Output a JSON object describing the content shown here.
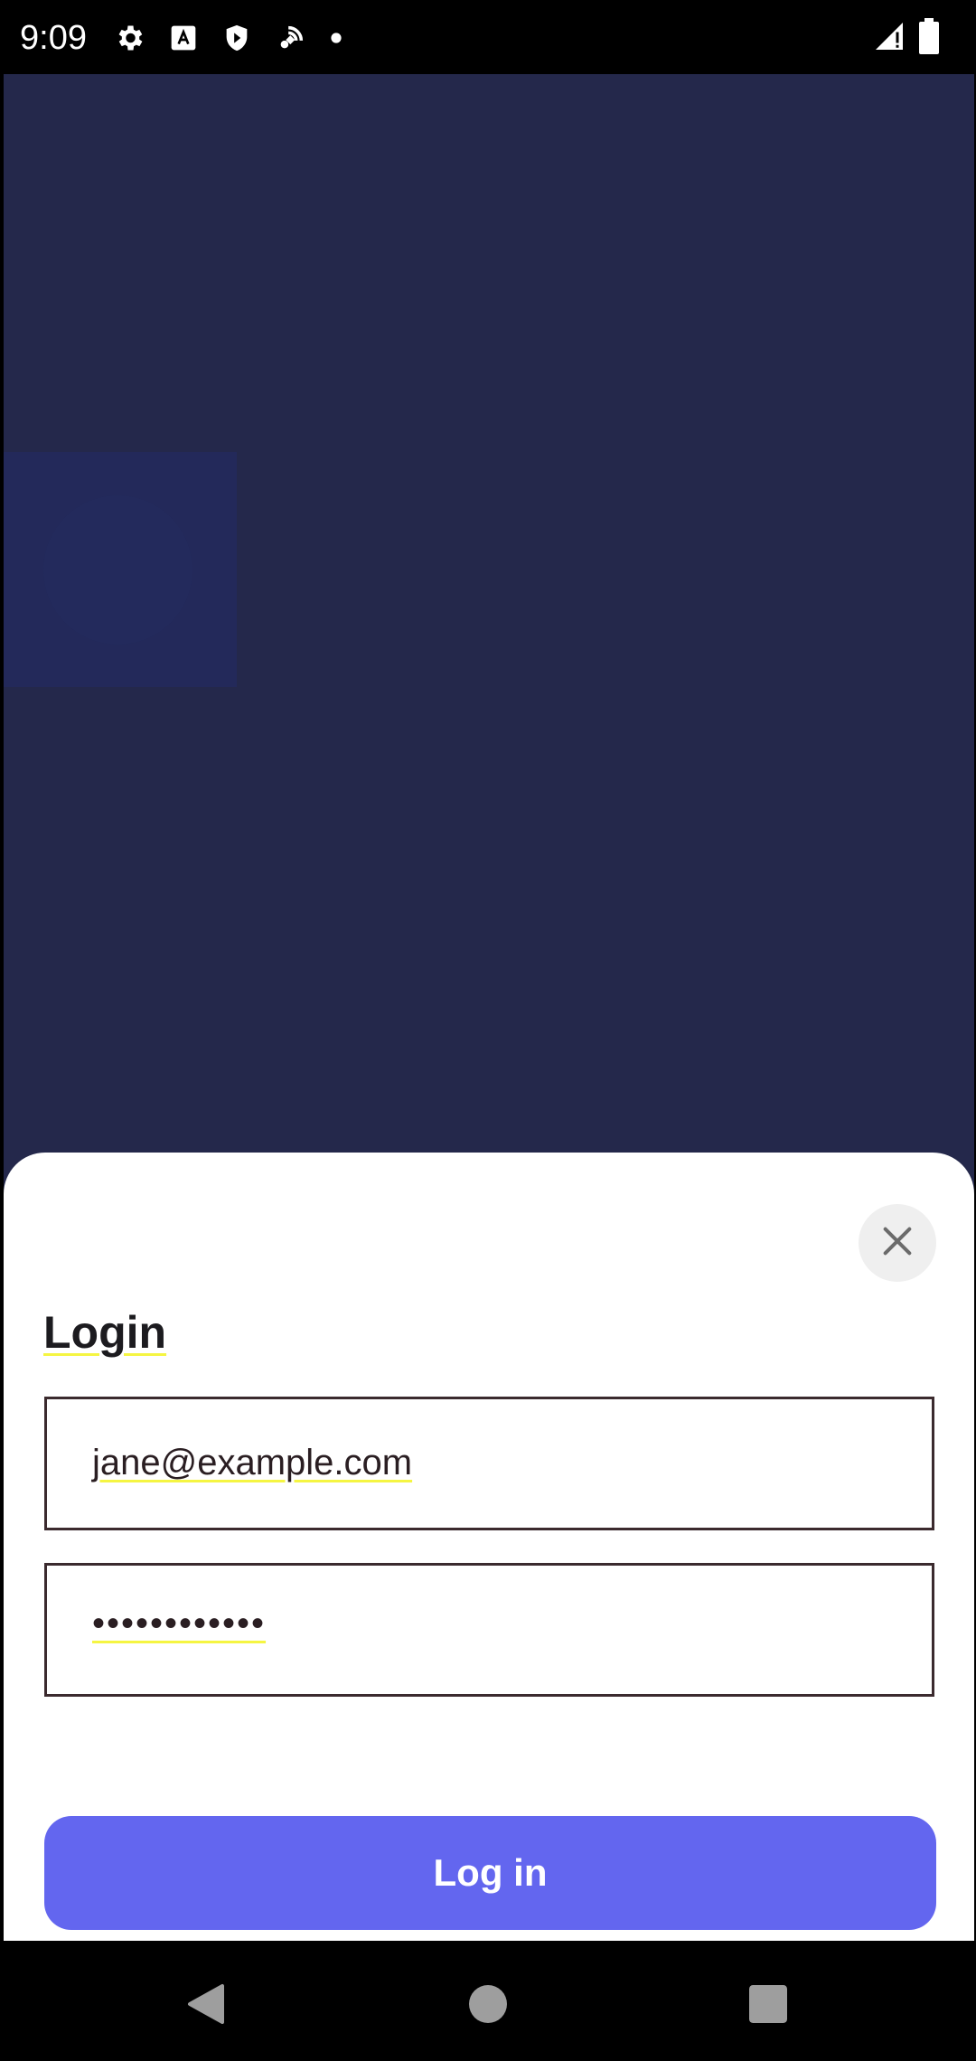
{
  "status_bar": {
    "time": "9:09",
    "left_icons": [
      "settings-icon",
      "font-a-icon",
      "shield-play-icon",
      "satellite-icon",
      "dot-icon"
    ],
    "right_icons": [
      "signal-icon",
      "battery-icon"
    ]
  },
  "login_sheet": {
    "title": "Login",
    "email_value": "jane@example.com",
    "password_value": "••••••••••••",
    "login_label": "Log in",
    "close_icon": "close-icon"
  },
  "nav_bar": {
    "icons": [
      "back-icon",
      "home-icon",
      "recents-icon"
    ]
  },
  "colors": {
    "app_background": "#24284b",
    "accent": "#6366ef",
    "sheet": "#ffffff",
    "field_border": "#3b2a2e"
  }
}
